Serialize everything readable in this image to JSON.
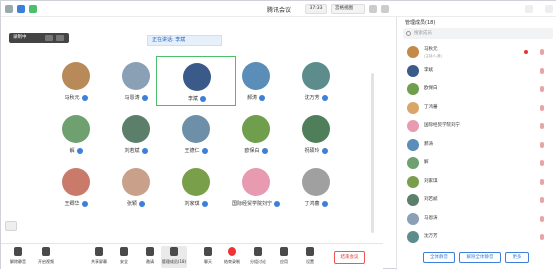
{
  "window": {
    "title": "腾讯会议",
    "timer": "37:33",
    "view_label": "宫格视图"
  },
  "panel": {
    "title": "管理成员(18)",
    "search_placeholder": "搜索成员",
    "members": [
      {
        "name": "马秋元",
        "sub": "(主持人,我)",
        "color": "#c48a4a",
        "recording": true
      },
      {
        "name": "李斌",
        "sub": "",
        "color": "#3a5a8a"
      },
      {
        "name": "欧保白",
        "sub": "",
        "color": "#6f9f4d"
      },
      {
        "name": "丁鸿蕃",
        "sub": "",
        "color": "#d9a66a"
      },
      {
        "name": "国际经贸学院刘宁",
        "sub": "",
        "color": "#e79ab0"
      },
      {
        "name": "郝涛",
        "sub": "",
        "color": "#5a8db8"
      },
      {
        "name": "解",
        "sub": "",
        "color": "#6fa06f"
      },
      {
        "name": "刘家琪",
        "sub": "",
        "color": "#7a9f4a"
      },
      {
        "name": "刘若斌",
        "sub": "",
        "color": "#5b7f6a"
      },
      {
        "name": "马恩涛",
        "sub": "",
        "color": "#8aa0b5"
      },
      {
        "name": "沈万芳",
        "sub": "",
        "color": "#5c8c8c"
      }
    ],
    "mute_all": "全体静音",
    "unmute_all": "解除全体静音",
    "more": "更多"
  },
  "main": {
    "recording_label": "录制中",
    "speaking": "正在讲话: 李斌",
    "grid": [
      {
        "name": "马秋元",
        "color": "#b88a5a"
      },
      {
        "name": "马恩涛",
        "color": "#8aa0b5"
      },
      {
        "name": "李斌",
        "color": "#3a5a8a",
        "active": true
      },
      {
        "name": "郝涛",
        "color": "#5a8db8"
      },
      {
        "name": "沈万芳",
        "color": "#5c8c8c"
      },
      {
        "name": "解",
        "color": "#6fa06f"
      },
      {
        "name": "刘若斌",
        "color": "#5b7f6a"
      },
      {
        "name": "王德仁",
        "color": "#6e8fa8"
      },
      {
        "name": "欧保白",
        "color": "#6f9f4d"
      },
      {
        "name": "祝硕玲",
        "color": "#4f7f5a"
      },
      {
        "name": "王卿华",
        "color": "#c97a6a"
      },
      {
        "name": "张颖",
        "color": "#c9a08a"
      },
      {
        "name": "刘家琪",
        "color": "#7a9f4a"
      },
      {
        "name": "国际经贸学院刘宁",
        "color": "#e79ab0"
      },
      {
        "name": "丁鸿蕃",
        "color": "#a0a0a0"
      }
    ]
  },
  "toolbar": {
    "items": [
      {
        "label": "解除静音",
        "icon": "mic-icon"
      },
      {
        "label": "开启视频",
        "icon": "camera-icon"
      },
      {
        "label": "共享屏幕",
        "icon": "screen-share-icon"
      },
      {
        "label": "安全",
        "icon": "shield-icon"
      },
      {
        "label": "邀请",
        "icon": "invite-icon"
      },
      {
        "label": "管理成员(18)",
        "icon": "members-icon"
      },
      {
        "label": "聊天",
        "icon": "chat-icon"
      },
      {
        "label": "结束录制",
        "icon": "record-icon"
      },
      {
        "label": "分组讨论",
        "icon": "breakout-icon"
      },
      {
        "label": "应用",
        "icon": "apps-icon"
      },
      {
        "label": "设置",
        "icon": "gear-icon"
      }
    ],
    "end_label": "结束会议"
  }
}
